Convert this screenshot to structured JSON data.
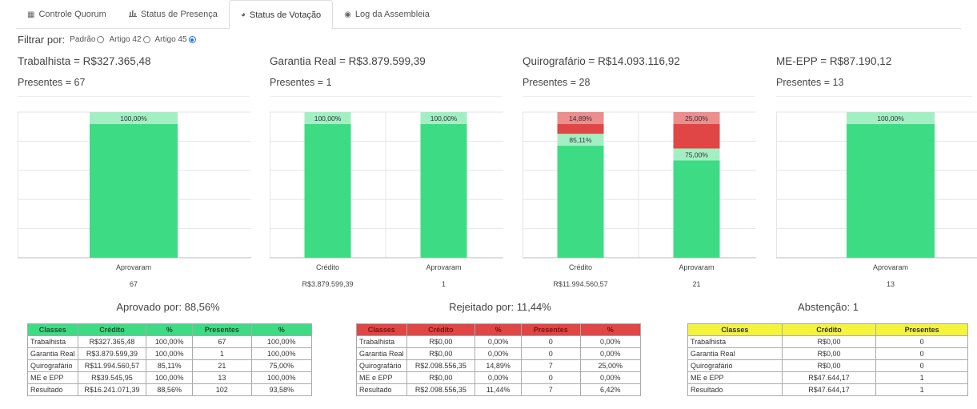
{
  "tabs": [
    {
      "label": "Controle Quorum",
      "icon": "table-icon"
    },
    {
      "label": "Status de Presença",
      "icon": "bar-chart-icon"
    },
    {
      "label": "Status de Votação",
      "icon": "globe-icon",
      "active": true
    },
    {
      "label": "Log da Assembleia",
      "icon": "eye-icon"
    }
  ],
  "filter": {
    "label": "Filtrar por:",
    "options": [
      "Padrão",
      "Artigo 42",
      "Artigo 45"
    ],
    "selected": "Artigo 45"
  },
  "classes": [
    {
      "title": "Trabalhista = R$327.365,48",
      "presentes": "Presentes = 67"
    },
    {
      "title": "Garantia Real = R$3.879.599,39",
      "presentes": "Presentes = 1"
    },
    {
      "title": "Quirografário = R$14.093.116,92",
      "presentes": "Presentes = 28"
    },
    {
      "title": "ME-EPP = R$87.190,12",
      "presentes": "Presentes = 13"
    }
  ],
  "chart_data": [
    {
      "type": "bar",
      "categories": [
        "Aprovaram"
      ],
      "series": [
        {
          "values": [
            100.0
          ],
          "color": "#3ddc84"
        }
      ],
      "value_labels": [
        "100,00%"
      ],
      "below_values": [
        "67"
      ],
      "ylim": [
        0,
        100
      ]
    },
    {
      "type": "bar",
      "categories": [
        "Crédito",
        "Aprovaram"
      ],
      "series": [
        {
          "values": [
            100.0,
            100.0
          ],
          "color": "#3ddc84"
        }
      ],
      "value_labels": [
        "100,00%",
        "100,00%"
      ],
      "below_values": [
        "R$3.879.599,39",
        "1"
      ],
      "ylim": [
        0,
        100
      ]
    },
    {
      "type": "bar",
      "stacked": true,
      "categories": [
        "Crédito",
        "Aprovaram"
      ],
      "series": [
        {
          "values": [
            85.11,
            75.0
          ],
          "labels": [
            "85,11%",
            "75,00%"
          ],
          "color": "#3ddc84"
        },
        {
          "values": [
            14.89,
            25.0
          ],
          "labels": [
            "14,89%",
            "25,00%"
          ],
          "color": "#e04646"
        }
      ],
      "below_values": [
        "R$11.994.560,57",
        "21"
      ],
      "ylim": [
        0,
        100
      ]
    },
    {
      "type": "bar",
      "categories": [
        "Aprovaram"
      ],
      "series": [
        {
          "values": [
            100.0
          ],
          "color": "#3ddc84"
        }
      ],
      "value_labels": [
        "100,00%"
      ],
      "below_values": [
        "13"
      ],
      "ylim": [
        0,
        100
      ]
    }
  ],
  "summary": {
    "aprovado": {
      "title": "Aprovado por: 88,56%",
      "headers": [
        "Classes",
        "Crédito",
        "%",
        "Presentes",
        "%"
      ],
      "rows": [
        [
          "Trabalhista",
          "R$327.365,48",
          "100,00%",
          "67",
          "100,00%"
        ],
        [
          "Garantia Real",
          "R$3.879.599,39",
          "100,00%",
          "1",
          "100,00%"
        ],
        [
          "Quirografário",
          "R$11.994.560,57",
          "85,11%",
          "21",
          "75,00%"
        ],
        [
          "ME e EPP",
          "R$39.545,95",
          "100,00%",
          "13",
          "100,00%"
        ],
        [
          "Resultado",
          "R$16.241.071,39",
          "88,56%",
          "102",
          "93,58%"
        ]
      ]
    },
    "rejeitado": {
      "title": "Rejeitado por: 11,44%",
      "headers": [
        "Classes",
        "Crédito",
        "%",
        "Presentes",
        "%"
      ],
      "rows": [
        [
          "Trabalhista",
          "R$0,00",
          "0,00%",
          "0",
          "0,00%"
        ],
        [
          "Garantia Real",
          "R$0,00",
          "0,00%",
          "0",
          "0,00%"
        ],
        [
          "Quirografário",
          "R$2.098.556,35",
          "14,89%",
          "7",
          "25,00%"
        ],
        [
          "ME e EPP",
          "R$0,00",
          "0,00%",
          "0",
          "0,00%"
        ],
        [
          "Resultado",
          "R$2.098.556,35",
          "11,44%",
          "7",
          "6,42%"
        ]
      ]
    },
    "abstencao": {
      "title": "Abstenção: 1",
      "headers": [
        "Classes",
        "Crédito",
        "Presentes"
      ],
      "rows": [
        [
          "Trabalhista",
          "R$0,00",
          "0"
        ],
        [
          "Garantia Real",
          "R$0,00",
          "0"
        ],
        [
          "Quirografário",
          "R$0,00",
          "0"
        ],
        [
          "ME e EPP",
          "R$47.644,17",
          "1"
        ],
        [
          "Resultado",
          "R$47.644,17",
          "1"
        ]
      ]
    }
  }
}
